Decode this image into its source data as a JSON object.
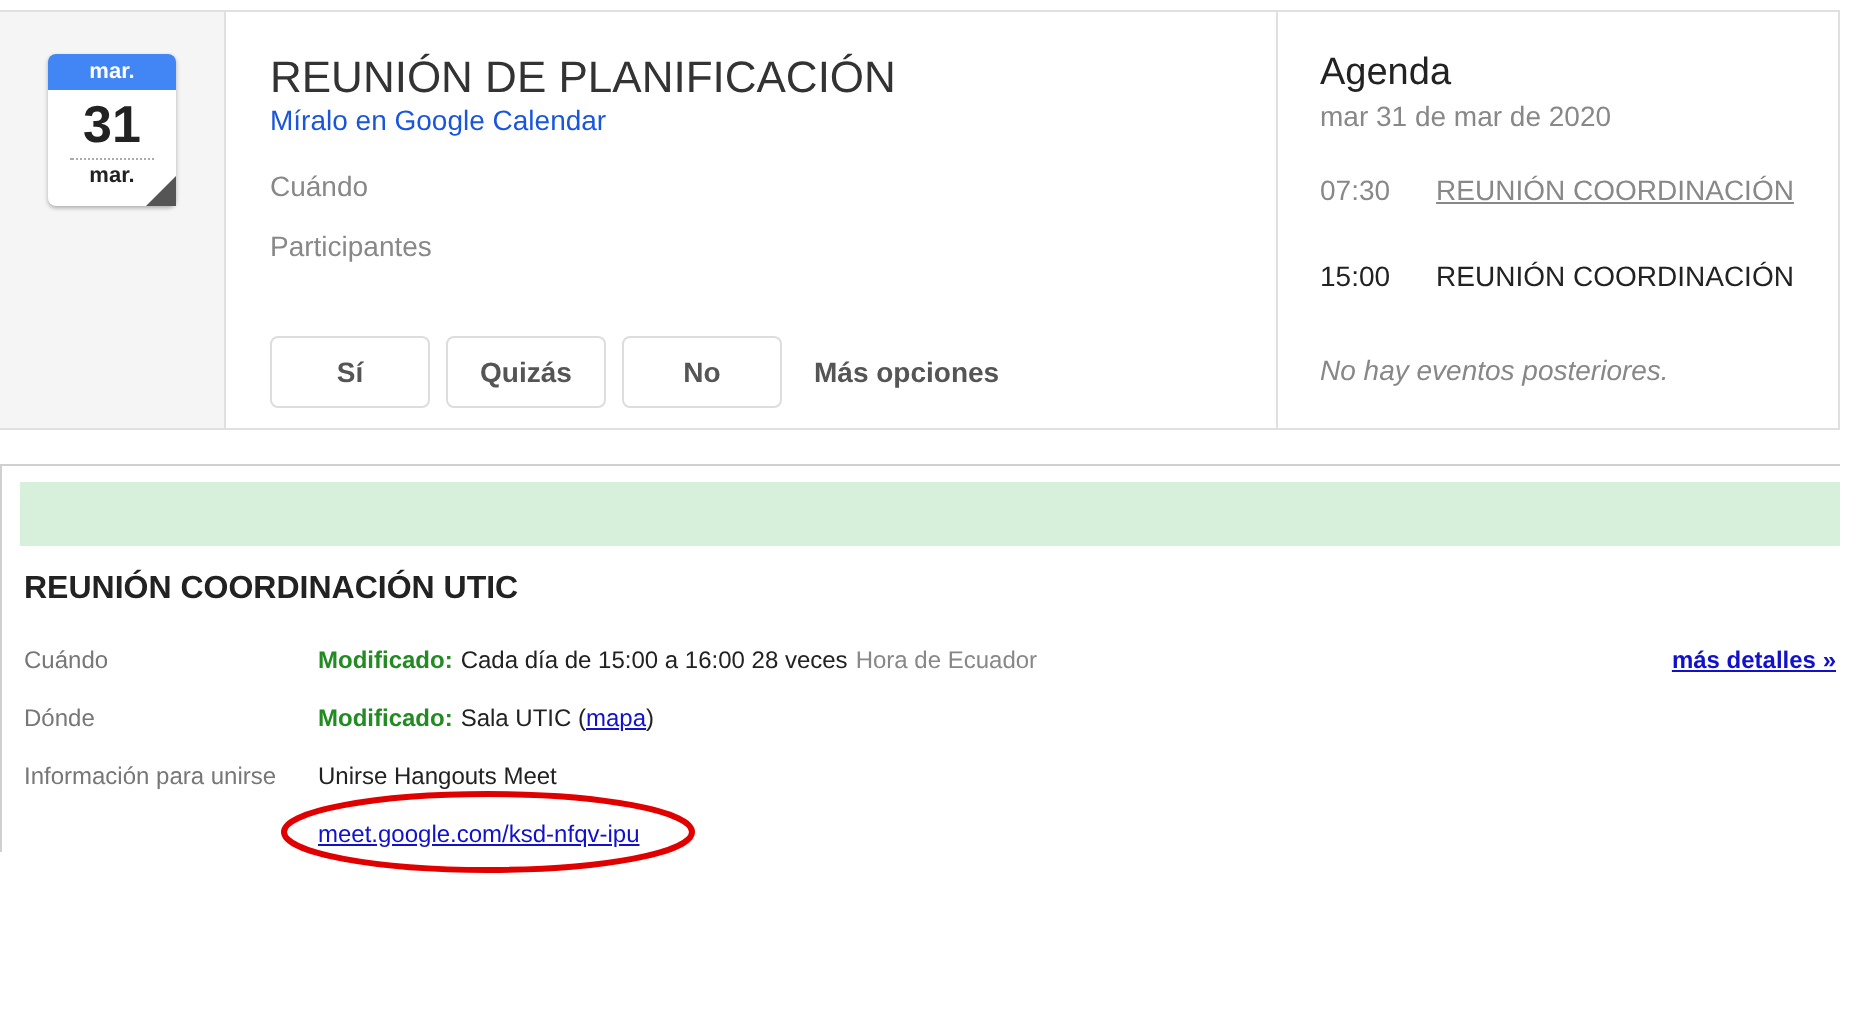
{
  "invite": {
    "calendar_icon": {
      "month_top": "mar.",
      "day": "31",
      "month_bottom": "mar."
    },
    "title": "REUNIÓN DE PLANIFICACIÓN",
    "calendar_link": "Míralo en Google Calendar",
    "fields": [
      "Cuándo",
      "Participantes"
    ],
    "rsvp_buttons": [
      "Sí",
      "Quizás",
      "No"
    ],
    "more_options": "Más opciones"
  },
  "agenda": {
    "title": "Agenda",
    "date": "mar 31 de mar de 2020",
    "events": [
      {
        "time": "07:30",
        "title": "REUNIÓN COORDINACIÓN",
        "past": true
      },
      {
        "time": "15:00",
        "title": "REUNIÓN COORDINACIÓN",
        "past": false
      }
    ],
    "empty_note": "No hay eventos posteriores."
  },
  "details": {
    "title": "REUNIÓN COORDINACIÓN UTIC",
    "more_details": "más detalles »",
    "rows": [
      {
        "label": "Cuándo",
        "parts": [
          {
            "kind": "modified",
            "text": "Modificado:"
          },
          {
            "kind": "text",
            "text": "Cada día de 15:00 a 16:00 28 veces"
          },
          {
            "kind": "muted",
            "text": "Hora de Ecuador"
          }
        ],
        "highlighted": false
      },
      {
        "label": "Dónde",
        "parts": [
          {
            "kind": "modified",
            "text": "Modificado:"
          },
          {
            "kind": "text",
            "text": "Sala UTIC ("
          },
          {
            "kind": "link",
            "text": "mapa"
          },
          {
            "kind": "text",
            "text": ")"
          }
        ],
        "highlighted": false
      },
      {
        "label": "Información para unirse",
        "parts": [
          {
            "kind": "text",
            "text": "Unirse Hangouts Meet"
          }
        ],
        "highlighted": false
      },
      {
        "parts": [
          {
            "kind": "link",
            "text": "meet.google.com/ksd-nfqv-ipu"
          }
        ],
        "highlighted": true
      }
    ]
  }
}
